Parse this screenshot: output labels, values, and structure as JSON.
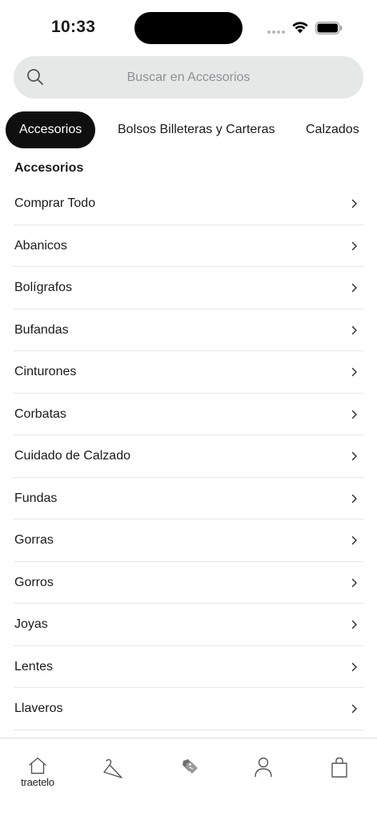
{
  "status_bar": {
    "time": "10:33"
  },
  "search": {
    "placeholder": "Buscar en Accesorios"
  },
  "tabs": [
    {
      "label": "Accesorios",
      "active": true
    },
    {
      "label": "Bolsos Billeteras y Carteras",
      "active": false
    },
    {
      "label": "Calzados",
      "active": false
    }
  ],
  "section": {
    "title": "Accesorios"
  },
  "items": [
    {
      "label": "Comprar Todo"
    },
    {
      "label": "Abanicos"
    },
    {
      "label": "Bolígrafos"
    },
    {
      "label": "Bufandas"
    },
    {
      "label": "Cinturones"
    },
    {
      "label": "Corbatas"
    },
    {
      "label": "Cuidado de Calzado"
    },
    {
      "label": "Fundas"
    },
    {
      "label": "Gorras"
    },
    {
      "label": "Gorros"
    },
    {
      "label": "Joyas"
    },
    {
      "label": "Lentes"
    },
    {
      "label": "Llaveros"
    }
  ],
  "tab_bar": {
    "brand": "traetelo",
    "items": [
      {
        "icon": "home-icon"
      },
      {
        "icon": "hanger-icon"
      },
      {
        "icon": "tags-icon"
      },
      {
        "icon": "person-icon"
      },
      {
        "icon": "shopping-bag-icon"
      }
    ]
  },
  "colors": {
    "active_tab_bg": "#0f0f0f",
    "search_bg": "#e6e8e8",
    "divider": "#e7e7e7"
  }
}
